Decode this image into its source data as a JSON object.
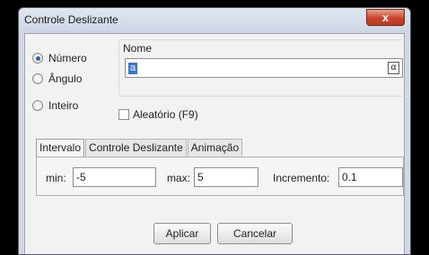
{
  "window": {
    "title": "Controle Deslizante",
    "close_symbol": "x"
  },
  "type_options": [
    {
      "label": "Número",
      "checked": true
    },
    {
      "label": "Ângulo",
      "checked": false
    },
    {
      "label": "Inteiro",
      "checked": false
    }
  ],
  "name": {
    "label": "Nome",
    "value": "a",
    "alpha_button": "α"
  },
  "random": {
    "label": "Aleatório (F9)",
    "checked": false
  },
  "tabs": [
    {
      "label": "Intervalo",
      "active": true
    },
    {
      "label": "Controle Deslizante",
      "active": false
    },
    {
      "label": "Animação",
      "active": false
    }
  ],
  "interval": {
    "min_label": "min:",
    "min_value": "-5",
    "max_label": "max:",
    "max_value": "5",
    "increment_label": "Incremento:",
    "increment_value": "0.1"
  },
  "buttons": {
    "apply": "Aplicar",
    "cancel": "Cancelar"
  },
  "colors": {
    "selection": "#3874d8",
    "close_button": "#c8452b",
    "frame": "#cfd8e4"
  }
}
